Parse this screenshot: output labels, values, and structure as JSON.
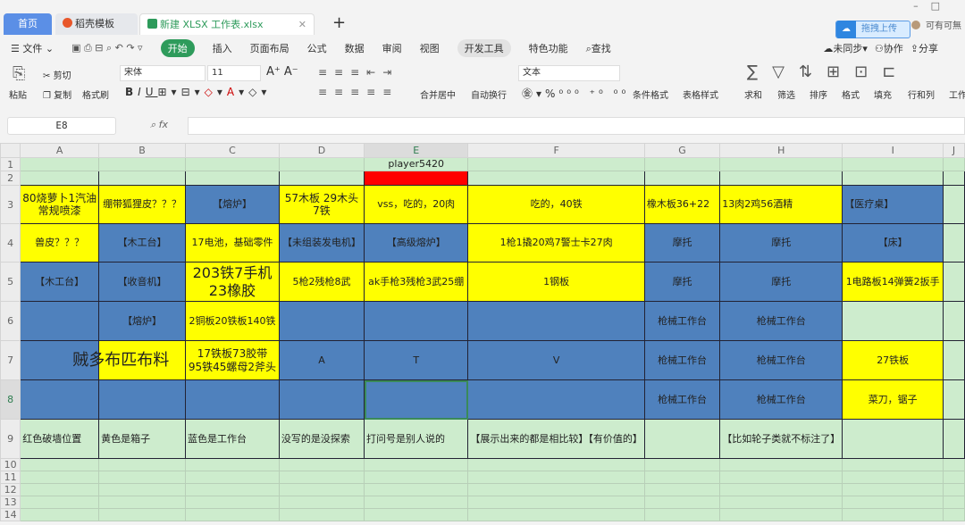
{
  "tabs": {
    "home": "首页",
    "templates": "稻壳模板",
    "file": "新建 XLSX 工作表.xlsx",
    "new_tab": "+"
  },
  "upload": "拖拽上传",
  "user": "可有可無",
  "menu": {
    "file": "文件",
    "start": "开始",
    "insert": "插入",
    "layout": "页面布局",
    "formula": "公式",
    "data": "数据",
    "review": "审阅",
    "view": "视图",
    "dev": "开发工具",
    "special": "特色功能",
    "search": "查找",
    "sync": "未同步",
    "collab": "协作",
    "share": "分享"
  },
  "ribbon": {
    "paste": "粘贴",
    "cut": "剪切",
    "copy": "复制",
    "format_painter": "格式刷",
    "font": "宋体",
    "size": "11",
    "merge": "合并居中",
    "wrap": "自动换行",
    "numfmt": "文本",
    "cond": "条件格式",
    "table_style": "表格样式",
    "sum": "求和",
    "filter": "筛选",
    "sort": "排序",
    "format": "格式",
    "fill": "填充",
    "rowcol": "行和列",
    "sheet": "工作"
  },
  "namebox": "E8",
  "formula": "",
  "columns": [
    "A",
    "B",
    "C",
    "D",
    "E",
    "F",
    "G",
    "H",
    "I",
    "J"
  ],
  "active_col": "E",
  "active_row": 8,
  "rows": [
    {
      "n": 1,
      "cells": [
        [
          "g",
          ""
        ],
        [
          "g",
          ""
        ],
        [
          "g",
          ""
        ],
        [
          "g",
          ""
        ],
        [
          "g",
          "player5420"
        ],
        [
          "g",
          ""
        ],
        [
          "g",
          ""
        ],
        [
          "g",
          ""
        ],
        [
          "g",
          ""
        ],
        [
          "g",
          ""
        ]
      ]
    },
    {
      "n": 2,
      "cells": [
        [
          "g",
          ""
        ],
        [
          "g",
          ""
        ],
        [
          "g",
          ""
        ],
        [
          "g",
          ""
        ],
        [
          "r",
          ""
        ],
        [
          "g",
          ""
        ],
        [
          "g",
          ""
        ],
        [
          "g",
          ""
        ],
        [
          "g",
          ""
        ],
        [
          "g",
          ""
        ]
      ]
    },
    {
      "n": 3,
      "cells": [
        [
          "y",
          "80烧萝卜1汽油\n常规喷漆"
        ],
        [
          "y",
          "绷带狐狸皮？？？"
        ],
        [
          "b",
          "【熔炉】"
        ],
        [
          "y",
          "57木板 29木头\n7铁"
        ],
        [
          "y",
          "vss，吃的，20肉"
        ],
        [
          "y",
          "吃的，40铁"
        ],
        [
          "y",
          "橡木板36+22"
        ],
        [
          "y",
          "13肉2鸡56酒精"
        ],
        [
          "b",
          "【医疗桌】"
        ],
        [
          "g",
          ""
        ]
      ]
    },
    {
      "n": 4,
      "cells": [
        [
          "y",
          "兽皮？？？"
        ],
        [
          "b",
          "【木工台】"
        ],
        [
          "y",
          "17电池，基础零件"
        ],
        [
          "b",
          "【未组装发电机】"
        ],
        [
          "b",
          "【高级熔炉】"
        ],
        [
          "y",
          "1枪1撬20鸡7警士卡27肉"
        ],
        [
          "b",
          "摩托"
        ],
        [
          "b",
          "摩托"
        ],
        [
          "b",
          "【床】"
        ],
        [
          "g",
          ""
        ]
      ]
    },
    {
      "n": 5,
      "cells": [
        [
          "b",
          "【木工台】"
        ],
        [
          "b",
          "【收音机】"
        ],
        [
          "y",
          "203铁7手机\n23橡胶"
        ],
        [
          "y",
          "5枪2残枪8武"
        ],
        [
          "y",
          "ak手枪3残枪3武25绷"
        ],
        [
          "y",
          "1钢板"
        ],
        [
          "b",
          "摩托"
        ],
        [
          "b",
          "摩托"
        ],
        [
          "y",
          "1电路板14弹簧2扳手"
        ],
        [
          "g",
          ""
        ]
      ]
    },
    {
      "n": 6,
      "cells": [
        [
          "b",
          ""
        ],
        [
          "b",
          "【熔炉】"
        ],
        [
          "y",
          "2铜板20铁板140铁"
        ],
        [
          "b",
          ""
        ],
        [
          "b",
          ""
        ],
        [
          "b",
          ""
        ],
        [
          "b",
          "枪械工作台"
        ],
        [
          "b",
          "枪械工作台"
        ],
        [
          "g",
          ""
        ],
        [
          "g",
          ""
        ]
      ]
    },
    {
      "n": 7,
      "cells": [
        [
          "b",
          "贼多布匹布料"
        ],
        [
          "y",
          ""
        ],
        [
          "y",
          "17铁板73胶带\n95铁45螺母2斧头"
        ],
        [
          "b",
          "A"
        ],
        [
          "b",
          "T"
        ],
        [
          "b",
          "V"
        ],
        [
          "b",
          "枪械工作台"
        ],
        [
          "b",
          "枪械工作台"
        ],
        [
          "y",
          "27铁板"
        ],
        [
          "g",
          ""
        ]
      ]
    },
    {
      "n": 8,
      "cells": [
        [
          "b",
          ""
        ],
        [
          "b",
          ""
        ],
        [
          "b",
          ""
        ],
        [
          "b",
          ""
        ],
        [
          "b",
          ""
        ],
        [
          "b",
          ""
        ],
        [
          "b",
          "枪械工作台"
        ],
        [
          "b",
          "枪械工作台"
        ],
        [
          "y",
          "菜刀，锯子"
        ],
        [
          "g",
          ""
        ]
      ]
    },
    {
      "n": 9,
      "cells": [
        [
          "g",
          "红色破墙位置"
        ],
        [
          "g",
          "黄色是箱子"
        ],
        [
          "g",
          "蓝色是工作台"
        ],
        [
          "g",
          "没写的是没探索"
        ],
        [
          "g",
          "打问号是别人说的"
        ],
        [
          "g",
          "【展示出来的都是相比较】【有价值的】"
        ],
        [
          "g",
          ""
        ],
        [
          "g",
          "【比如轮子类就不标注了】"
        ],
        [
          "g",
          ""
        ],
        [
          "g",
          ""
        ]
      ]
    },
    {
      "n": 10,
      "cells": [
        [
          "g",
          ""
        ],
        [
          "g",
          ""
        ],
        [
          "g",
          ""
        ],
        [
          "g",
          ""
        ],
        [
          "g",
          ""
        ],
        [
          "g",
          ""
        ],
        [
          "g",
          ""
        ],
        [
          "g",
          ""
        ],
        [
          "g",
          ""
        ],
        [
          "g",
          ""
        ]
      ]
    },
    {
      "n": 11,
      "cells": [
        [
          "g",
          ""
        ],
        [
          "g",
          ""
        ],
        [
          "g",
          ""
        ],
        [
          "g",
          ""
        ],
        [
          "g",
          ""
        ],
        [
          "g",
          ""
        ],
        [
          "g",
          ""
        ],
        [
          "g",
          ""
        ],
        [
          "g",
          ""
        ],
        [
          "g",
          ""
        ]
      ]
    },
    {
      "n": 12,
      "cells": [
        [
          "g",
          ""
        ],
        [
          "g",
          ""
        ],
        [
          "g",
          ""
        ],
        [
          "g",
          ""
        ],
        [
          "g",
          ""
        ],
        [
          "g",
          ""
        ],
        [
          "g",
          ""
        ],
        [
          "g",
          ""
        ],
        [
          "g",
          ""
        ],
        [
          "g",
          ""
        ]
      ]
    },
    {
      "n": 13,
      "cells": [
        [
          "g",
          ""
        ],
        [
          "g",
          ""
        ],
        [
          "g",
          ""
        ],
        [
          "g",
          ""
        ],
        [
          "g",
          ""
        ],
        [
          "g",
          ""
        ],
        [
          "g",
          ""
        ],
        [
          "g",
          ""
        ],
        [
          "g",
          ""
        ],
        [
          "g",
          ""
        ]
      ]
    },
    {
      "n": 14,
      "cells": [
        [
          "g",
          ""
        ],
        [
          "g",
          ""
        ],
        [
          "g",
          ""
        ],
        [
          "g",
          ""
        ],
        [
          "g",
          ""
        ],
        [
          "g",
          ""
        ],
        [
          "g",
          ""
        ],
        [
          "g",
          ""
        ],
        [
          "g",
          ""
        ],
        [
          "g",
          ""
        ]
      ]
    }
  ]
}
